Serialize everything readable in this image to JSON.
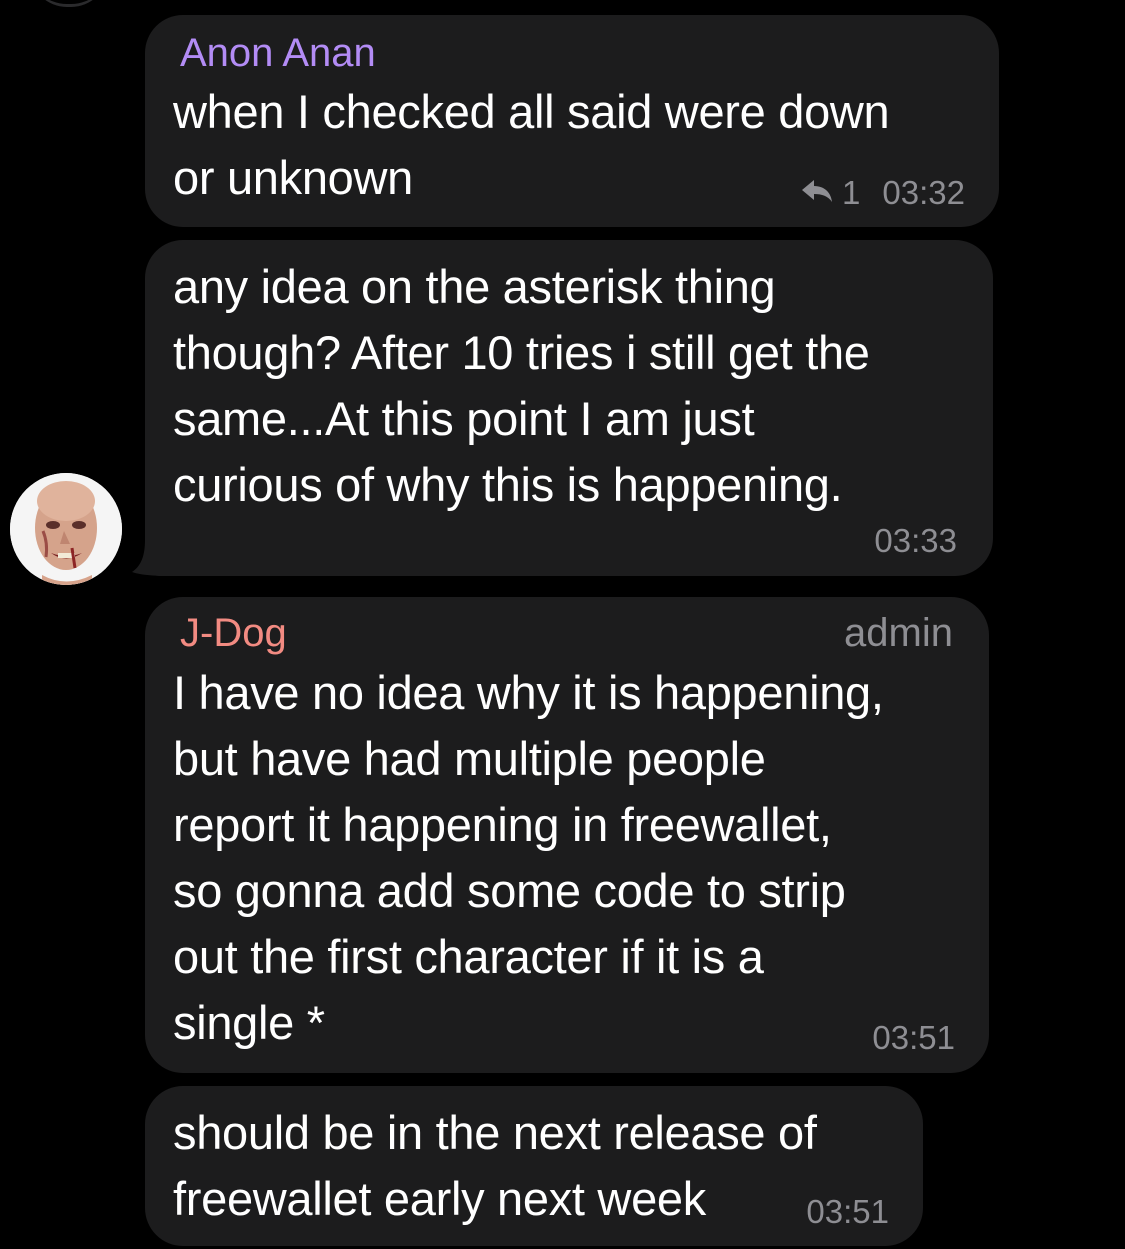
{
  "colors": {
    "background": "#000000",
    "bubble": "#1c1c1d",
    "text": "#ffffff",
    "meta": "#8e8e93",
    "anon_name": "#b38cf5",
    "jdog_name": "#f28b82"
  },
  "messages": [
    {
      "sender": "Anon Anan",
      "text": "when I checked all said were down\nor unknown",
      "reply_icon": "reply-arrow-icon",
      "reply_count": "1",
      "time": "03:32"
    },
    {
      "text": "any idea on the asterisk thing\nthough? After 10 tries i still get the\nsame...At this point I am just\ncurious of why this is happening.",
      "time": "03:33",
      "avatar": "user-avatar"
    },
    {
      "sender": "J-Dog",
      "role": "admin",
      "text": "I have no idea why it is happening,\nbut have had multiple people\nreport it happening in freewallet,\nso gonna add some code to strip\nout the first character if it is a\nsingle *",
      "time": "03:51"
    },
    {
      "text": "should be in the next release of\nfreewallet early next week",
      "time": "03:51"
    }
  ]
}
